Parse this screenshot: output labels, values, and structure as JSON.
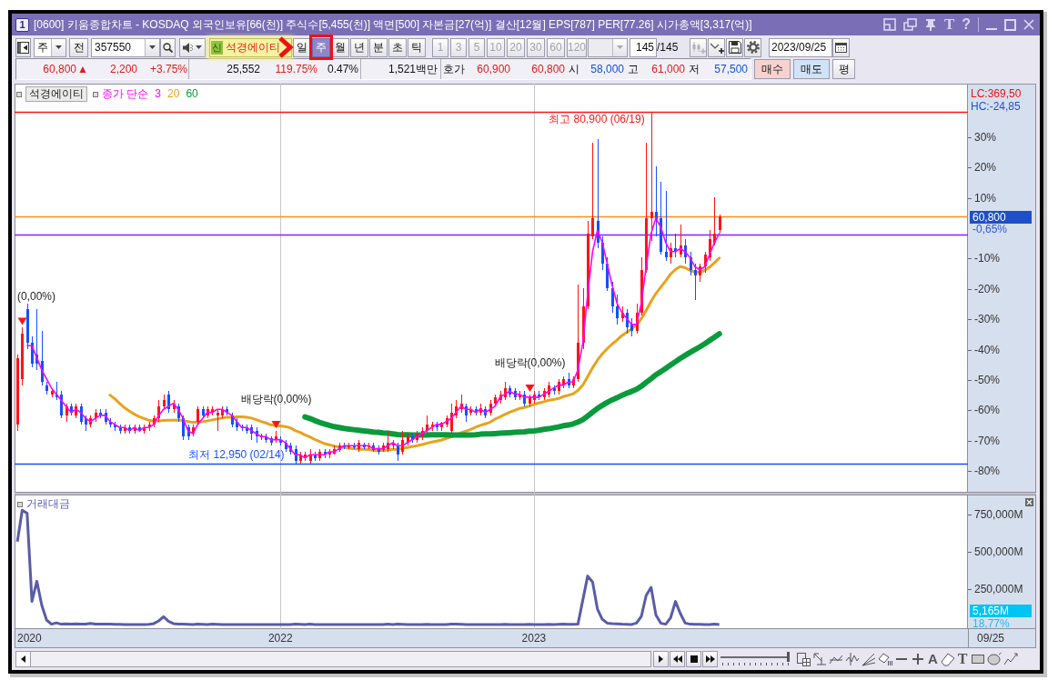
{
  "window": {
    "badge": "1",
    "title": "[0600] 키움종합차트 - KOSDAQ 외국인보유[66(천)] 주식수[5,455(천)] 액면[500] 자본금[27(억)] 결산[12월] EPS[787] PER[77.26] 시가총액[3,317(억)]",
    "font_button": "T",
    "help_button": "?"
  },
  "toolbar": {
    "market": "주",
    "all_button": "전",
    "code": "357550",
    "credit_badge": "신",
    "stock_name": "석경에이티",
    "periods": [
      {
        "label": "일",
        "selected": false
      },
      {
        "label": "주",
        "selected": true
      },
      {
        "label": "월",
        "selected": false
      },
      {
        "label": "년",
        "selected": false
      },
      {
        "label": "분",
        "selected": false
      },
      {
        "label": "초",
        "selected": false
      },
      {
        "label": "틱",
        "selected": false
      }
    ],
    "intervals": [
      {
        "label": "1",
        "disabled": true
      },
      {
        "label": "3",
        "disabled": true
      },
      {
        "label": "5",
        "disabled": true
      },
      {
        "label": "10",
        "disabled": true
      },
      {
        "label": "20",
        "disabled": true
      },
      {
        "label": "30",
        "disabled": true
      },
      {
        "label": "60",
        "disabled": true
      },
      {
        "label": "120",
        "disabled": true
      }
    ],
    "count": "145",
    "total": "/145",
    "date": "2023/09/25"
  },
  "quote": {
    "price": "60,800",
    "price_mark": "▲",
    "change": "2,200",
    "rate": "+3.75%",
    "up": true,
    "volume": "25,552",
    "volume_ratio": {
      "value": "119.75%",
      "up": true
    },
    "turnover": "0.47%",
    "trade_value": "1,521백만",
    "ask_label": "호가",
    "asks": [
      {
        "value": "60,900",
        "up": true
      },
      {
        "value": "60,800",
        "up": true
      }
    ],
    "prices": [
      {
        "label": "시",
        "value": "58,000",
        "up": false
      },
      {
        "label": "고",
        "value": "61,000",
        "up": true
      },
      {
        "label": "저",
        "value": "57,500",
        "up": false
      }
    ]
  },
  "order_buttons": [
    {
      "label": "매수",
      "kind": "buy"
    },
    {
      "label": "매도",
      "kind": "sell"
    },
    {
      "label": "평",
      "kind": "plain"
    }
  ],
  "price_pane": {
    "series_button": "석경에이티",
    "axis_notes": {
      "lc": "LC:369,50",
      "hc": "HC:-24,85"
    },
    "price_marker": {
      "value": "60,800",
      "change": "-0,65%"
    },
    "chart_data": [
      {
        "type": "candlestick",
        "legend_title": "종가 단순",
        "annotations": [
          "(0,00%)",
          "배당락(0,00%)",
          "배당락(0,00%)"
        ],
        "x": [
          "2020-12-21",
          "2020-12-28",
          "2021-01-04",
          "2021-01-11",
          "2021-01-18",
          "2021-01-25",
          "2021-02-01",
          "2021-02-08",
          "2021-02-15",
          "2021-02-22",
          "2021-03-01",
          "2021-03-08",
          "2021-03-15",
          "2021-03-22",
          "2021-03-29",
          "2021-04-05",
          "2021-04-12",
          "2021-04-19",
          "2021-04-26",
          "2021-05-03",
          "2021-05-10",
          "2021-05-17",
          "2021-05-24",
          "2021-05-31",
          "2021-06-07",
          "2021-06-14",
          "2021-06-21",
          "2021-06-28",
          "2021-07-05",
          "2021-07-12",
          "2021-07-19",
          "2021-07-26",
          "2021-08-02",
          "2021-08-09",
          "2021-08-16",
          "2021-08-23",
          "2021-08-30",
          "2021-09-06",
          "2021-09-13",
          "2021-09-20",
          "2021-09-27",
          "2021-10-04",
          "2021-10-11",
          "2021-10-18",
          "2021-10-25",
          "2021-11-01",
          "2021-11-08",
          "2021-11-15",
          "2021-11-22",
          "2021-11-29",
          "2021-12-06",
          "2021-12-13",
          "2021-12-20",
          "2021-12-27",
          "2022-01-03",
          "2022-01-10",
          "2022-01-17",
          "2022-01-24",
          "2022-01-31",
          "2022-02-07",
          "2022-02-14",
          "2022-02-21",
          "2022-02-28",
          "2022-03-07",
          "2022-03-14",
          "2022-03-21",
          "2022-03-28",
          "2022-04-04",
          "2022-04-11",
          "2022-04-18",
          "2022-04-25",
          "2022-05-02",
          "2022-05-09",
          "2022-05-16",
          "2022-05-23",
          "2022-05-30",
          "2022-06-06",
          "2022-06-13",
          "2022-06-20",
          "2022-06-27",
          "2022-07-04",
          "2022-07-11",
          "2022-07-18",
          "2022-07-25",
          "2022-08-01",
          "2022-08-08",
          "2022-08-15",
          "2022-08-22",
          "2022-08-29",
          "2022-09-05",
          "2022-09-12",
          "2022-09-19",
          "2022-09-26",
          "2022-10-03",
          "2022-10-10",
          "2022-10-17",
          "2022-10-24",
          "2022-10-31",
          "2022-11-07",
          "2022-11-14",
          "2022-11-21",
          "2022-11-28",
          "2022-12-05",
          "2022-12-12",
          "2022-12-19",
          "2022-12-26",
          "2023-01-02",
          "2023-01-09",
          "2023-01-16",
          "2023-01-23",
          "2023-01-30",
          "2023-02-06",
          "2023-02-13",
          "2023-02-20",
          "2023-02-27",
          "2023-03-06",
          "2023-03-13",
          "2023-03-20",
          "2023-03-27",
          "2023-04-03",
          "2023-04-10",
          "2023-04-17",
          "2023-04-24",
          "2023-05-01",
          "2023-05-08",
          "2023-05-15",
          "2023-05-22",
          "2023-05-29",
          "2023-06-05",
          "2023-06-12",
          "2023-06-19",
          "2023-06-26",
          "2023-07-03",
          "2023-07-10",
          "2023-07-17",
          "2023-07-24",
          "2023-07-31",
          "2023-08-07",
          "2023-08-14",
          "2023-08-21",
          "2023-08-28",
          "2023-09-04",
          "2023-09-11",
          "2023-09-18",
          "2023-09-25"
        ],
        "ohlc": [
          [
            -65,
            -42,
            -67,
            -43
          ],
          [
            -50,
            -33,
            -52,
            -35
          ],
          [
            -27,
            -25,
            -40,
            -38
          ],
          [
            -38,
            -36,
            -46,
            -45
          ],
          [
            -42,
            -27,
            -47,
            -45
          ],
          [
            -44,
            -34,
            -52,
            -51
          ],
          [
            -52,
            -51,
            -55,
            -54
          ],
          [
            -55,
            -53,
            -56,
            -54
          ],
          [
            -55,
            -51,
            -57,
            -56
          ],
          [
            -55,
            -54,
            -63,
            -62
          ],
          [
            -62,
            -58,
            -64,
            -59
          ],
          [
            -59,
            -58,
            -62,
            -61
          ],
          [
            -62,
            -58,
            -63,
            -59
          ],
          [
            -59,
            -58,
            -65,
            -64
          ],
          [
            -63,
            -62,
            -67,
            -65
          ],
          [
            -65,
            -62,
            -66,
            -63
          ],
          [
            -63,
            -60,
            -64,
            -61
          ],
          [
            -61,
            -60,
            -63,
            -62
          ],
          [
            -61,
            -60,
            -65,
            -64
          ],
          [
            -64,
            -63,
            -66,
            -65
          ],
          [
            -65,
            -64,
            -67,
            -66
          ],
          [
            -66,
            -65,
            -68,
            -67
          ],
          [
            -67,
            -65,
            -68,
            -66
          ],
          [
            -66,
            -65,
            -68,
            -67
          ],
          [
            -67,
            -65,
            -68,
            -66
          ],
          [
            -66,
            -65,
            -67.5,
            -67
          ],
          [
            -67,
            -65,
            -68,
            -66
          ],
          [
            -66,
            -64,
            -67,
            -65
          ],
          [
            -65,
            -62,
            -66,
            -63
          ],
          [
            -63,
            -57,
            -64,
            -59
          ],
          [
            -59,
            -55,
            -60,
            -57
          ],
          [
            -55,
            -54,
            -61,
            -60
          ],
          [
            -60,
            -57,
            -61,
            -58
          ],
          [
            -59,
            -58,
            -64,
            -63
          ],
          [
            -63,
            -62,
            -70,
            -69
          ],
          [
            -66,
            -65,
            -70,
            -69
          ],
          [
            -68,
            -65,
            -69,
            -66
          ],
          [
            -64,
            -59,
            -65,
            -60
          ],
          [
            -60,
            -59,
            -63,
            -62
          ],
          [
            -62,
            -59,
            -63,
            -60
          ],
          [
            -61,
            -59,
            -62,
            -60
          ],
          [
            -62,
            -60,
            -67,
            -61
          ],
          [
            -62,
            -59,
            -63,
            -60
          ],
          [
            -60,
            -59,
            -62,
            -61
          ],
          [
            -62,
            -61,
            -66,
            -65
          ],
          [
            -64,
            -63,
            -67,
            -66
          ],
          [
            -65.5,
            -65,
            -67,
            -66
          ],
          [
            -66,
            -65,
            -68,
            -67
          ],
          [
            -66,
            -65,
            -70,
            -68
          ],
          [
            -67,
            -66,
            -71,
            -69
          ],
          [
            -68.5,
            -68,
            -70,
            -69
          ],
          [
            -69,
            -68,
            -71,
            -70
          ],
          [
            -69.5,
            -69,
            -72,
            -71
          ],
          [
            -70,
            -67,
            -71,
            -69
          ],
          [
            -70,
            -69,
            -72,
            -71
          ],
          [
            -71,
            -70,
            -74,
            -73
          ],
          [
            -72,
            -71,
            -75,
            -74
          ],
          [
            -73,
            -72,
            -78,
            -77
          ],
          [
            -77,
            -74,
            -78,
            -75
          ],
          [
            -76,
            -74,
            -77,
            -75
          ],
          [
            -77,
            -73,
            -77.9,
            -75
          ],
          [
            -75,
            -74,
            -77,
            -76
          ],
          [
            -76,
            -73,
            -77,
            -74
          ],
          [
            -74,
            -73,
            -76,
            -75
          ],
          [
            -75,
            -73,
            -76,
            -74
          ],
          [
            -74.5,
            -72,
            -75,
            -73
          ],
          [
            -73.5,
            -71,
            -74,
            -72
          ],
          [
            -72,
            -71,
            -73,
            -72.5
          ],
          [
            -72.5,
            -71,
            -73,
            -72
          ],
          [
            -72,
            -71,
            -73,
            -72.5
          ],
          [
            -73,
            -70,
            -74,
            -71
          ],
          [
            -71.5,
            -71,
            -73,
            -72.5
          ],
          [
            -72.5,
            -71,
            -73,
            -72
          ],
          [
            -72,
            -71,
            -74,
            -73.5
          ],
          [
            -73,
            -72,
            -75,
            -74
          ],
          [
            -73.5,
            -71,
            -74,
            -72
          ],
          [
            -73,
            -67,
            -74,
            -71
          ],
          [
            -72,
            -70,
            -73,
            -71.5
          ],
          [
            -72,
            -71,
            -77,
            -75
          ],
          [
            -74,
            -67,
            -75,
            -70
          ],
          [
            -71,
            -68,
            -72,
            -69
          ],
          [
            -69,
            -68,
            -71,
            -70
          ],
          [
            -70,
            -67,
            -71,
            -68
          ],
          [
            -69,
            -66,
            -70,
            -67
          ],
          [
            -67,
            -62,
            -68,
            -65
          ],
          [
            -66,
            -64,
            -67,
            -65
          ],
          [
            -65,
            -64,
            -67,
            -66
          ],
          [
            -66,
            -64,
            -67,
            -64.5
          ],
          [
            -65,
            -62,
            -66,
            -63
          ],
          [
            -67,
            -58,
            -68,
            -61
          ],
          [
            -62,
            -57,
            -63,
            -59
          ],
          [
            -60,
            -55,
            -61,
            -58
          ],
          [
            -59,
            -58,
            -64,
            -62
          ],
          [
            -61,
            -59,
            -62,
            -60
          ],
          [
            -60,
            -59,
            -62,
            -61
          ],
          [
            -61,
            -58,
            -62,
            -59.5
          ],
          [
            -60,
            -59,
            -63,
            -62
          ],
          [
            -61,
            -57,
            -62,
            -58
          ],
          [
            -58,
            -55,
            -59,
            -56
          ],
          [
            -57,
            -54,
            -58,
            -55
          ],
          [
            -56,
            -51,
            -57,
            -53
          ],
          [
            -53,
            -52,
            -56,
            -55
          ],
          [
            -54,
            -53,
            -57,
            -56
          ],
          [
            -56,
            -54,
            -57,
            -55
          ],
          [
            -55,
            -54,
            -59,
            -58
          ],
          [
            -58,
            -55,
            -59,
            -56
          ],
          [
            -57,
            -54,
            -58,
            -55
          ],
          [
            -55,
            -54,
            -57,
            -56
          ],
          [
            -56,
            -53,
            -57,
            -54
          ],
          [
            -55,
            -51,
            -56,
            -52
          ],
          [
            -53,
            -52,
            -55,
            -54
          ],
          [
            -54,
            -50,
            -55,
            -51
          ],
          [
            -52,
            -49,
            -53,
            -50
          ],
          [
            -50,
            -48,
            -53,
            -52
          ],
          [
            -52,
            -49,
            -53,
            -50
          ],
          [
            -50,
            -19,
            -51,
            -38
          ],
          [
            -38,
            -20,
            -40,
            -26
          ],
          [
            -26,
            2,
            -27,
            -2
          ],
          [
            -3,
            28,
            -4,
            3
          ],
          [
            2,
            29,
            -7,
            -5
          ],
          [
            -5,
            -3,
            -14,
            -12
          ],
          [
            -12,
            -10,
            -21,
            -20
          ],
          [
            -20,
            -18,
            -28,
            -26
          ],
          [
            -26,
            -22,
            -32,
            -30
          ],
          [
            -30,
            -26,
            -31,
            -28
          ],
          [
            -28,
            -27,
            -35,
            -33
          ],
          [
            -32,
            -30,
            -36,
            -34
          ],
          [
            -34,
            -25,
            -35,
            -28
          ],
          [
            -28,
            -10,
            -29,
            -14
          ],
          [
            -14,
            28,
            -15,
            3
          ],
          [
            3,
            38.1,
            -4.5,
            5
          ],
          [
            5,
            20,
            -3,
            2
          ],
          [
            3,
            15,
            -9,
            -8
          ],
          [
            -8,
            12,
            -11,
            -10
          ],
          [
            -10,
            -5,
            -12,
            -7
          ],
          [
            -7,
            -2,
            -10,
            -8
          ],
          [
            -9,
            1,
            -10,
            -6
          ],
          [
            -6,
            -4,
            -12,
            -10
          ],
          [
            -10,
            -8,
            -16,
            -14
          ],
          [
            -14,
            -12,
            -24,
            -16
          ],
          [
            -16,
            -12,
            -18,
            -13
          ],
          [
            -13,
            -8,
            -15,
            -9
          ],
          [
            -10,
            -1,
            -11,
            -4
          ],
          [
            -5,
            10,
            -6,
            -2
          ],
          [
            -1,
            4.1,
            -1.9,
            3.75
          ]
        ],
        "series": [
          {
            "name": "3",
            "type": "line",
            "color": "#ff00ff",
            "values": [
              null,
              null,
              -39,
              -39,
              -43,
              -47,
              -50,
              -53,
              -55,
              -57,
              -59,
              -61,
              -60,
              -61,
              -63,
              -64,
              -63,
              -62,
              -62,
              -64,
              -65,
              -66,
              -66,
              -67,
              -66,
              -67,
              -66,
              -66,
              -65,
              -62,
              -60,
              -59,
              -58,
              -60,
              -63,
              -67,
              -68,
              -65,
              -63,
              -61,
              -61,
              -60,
              -60,
              -61,
              -62,
              -64,
              -66,
              -66,
              -67,
              -68,
              -69,
              -69,
              -70,
              -70,
              -70,
              -71,
              -73,
              -75,
              -75,
              -76,
              -75,
              -75,
              -75,
              -75,
              -74,
              -74,
              -73,
              -72,
              -72,
              -72,
              -72,
              -72,
              -72,
              -73,
              -73,
              -73,
              -72,
              -71,
              -72,
              -72,
              -71,
              -70,
              -69,
              -68,
              -67,
              -66,
              -65,
              -65,
              -64,
              -63,
              -61,
              -59,
              -60,
              -60,
              -61,
              -60,
              -61,
              -60,
              -59,
              -56,
              -55,
              -54,
              -55,
              -55,
              -56,
              -56,
              -56,
              -56,
              -55,
              -54,
              -53,
              -52,
              -52,
              -51,
              -51,
              -47,
              -38,
              -22,
              -8,
              -1,
              -5,
              -12,
              -19,
              -25,
              -28,
              -30,
              -32,
              -32,
              -25,
              -13,
              -2,
              3,
              0,
              -5,
              -8,
              -8,
              -7,
              -8,
              -10,
              -13,
              -14,
              -13,
              -9,
              -5,
              -2
            ]
          },
          {
            "name": "20",
            "type": "line",
            "color": "#e9a21b",
            "values": [
              null,
              null,
              null,
              null,
              null,
              null,
              null,
              null,
              null,
              null,
              null,
              null,
              null,
              null,
              null,
              null,
              null,
              null,
              null,
              -55.3,
              -56.5,
              -58.1,
              -59.5,
              -60.6,
              -61.6,
              -62.4,
              -63,
              -63.6,
              -63.9,
              -63.8,
              -63.7,
              -63.6,
              -63.6,
              -63.5,
              -63.7,
              -64,
              -64.3,
              -64.2,
              -64.1,
              -63.8,
              -63.5,
              -63.2,
              -62.9,
              -62.6,
              -62.6,
              -62.5,
              -62.5,
              -62.6,
              -62.9,
              -63.4,
              -64,
              -64.5,
              -65.1,
              -65.4,
              -65.5,
              -65.7,
              -66.1,
              -67,
              -67.6,
              -68.4,
              -69.1,
              -69.9,
              -70.6,
              -71.3,
              -71.7,
              -72.1,
              -72.4,
              -72.6,
              -72.8,
              -73,
              -73.1,
              -73.2,
              -73.3,
              -73.5,
              -73.7,
              -73.6,
              -73.5,
              -73.2,
              -73.2,
              -72.9,
              -72.6,
              -72.3,
              -72,
              -71.6,
              -71.2,
              -70.8,
              -70.5,
              -70.1,
              -69.6,
              -69.1,
              -68.5,
              -67.7,
              -67.2,
              -66.6,
              -65.9,
              -65.3,
              -64.8,
              -64.2,
              -63.2,
              -62.5,
              -61.7,
              -60.9,
              -60.3,
              -59.7,
              -59.4,
              -58.9,
              -58.4,
              -57.9,
              -57.5,
              -57,
              -56.8,
              -56.4,
              -55.8,
              -55.4,
              -54.9,
              -53.8,
              -52,
              -49.2,
              -46.3,
              -43.8,
              -41.7,
              -40,
              -38.5,
              -37.2,
              -35.7,
              -34.6,
              -33.5,
              -32.1,
              -30.1,
              -27.4,
              -24.4,
              -21.8,
              -19.7,
              -17.6,
              -15.4,
              -13.9,
              -12.9,
              -13.3,
              -14.2,
              -14.7,
              -14.8,
              -14.2,
              -13.1,
              -11.7,
              -10.1
            ]
          },
          {
            "name": "60",
            "type": "line",
            "color": "#0a9a3c",
            "values": [
              null,
              null,
              null,
              null,
              null,
              null,
              null,
              null,
              null,
              null,
              null,
              null,
              null,
              null,
              null,
              null,
              null,
              null,
              null,
              null,
              null,
              null,
              null,
              null,
              null,
              null,
              null,
              null,
              null,
              null,
              null,
              null,
              null,
              null,
              null,
              null,
              null,
              null,
              null,
              null,
              null,
              null,
              null,
              null,
              null,
              null,
              null,
              null,
              null,
              null,
              null,
              null,
              null,
              null,
              null,
              null,
              null,
              null,
              null,
              -62.5,
              -63,
              -63.7,
              -64.3,
              -64.8,
              -65.3,
              -65.7,
              -66,
              -66.3,
              -66.5,
              -66.7,
              -66.9,
              -67.1,
              -67.3,
              -67.5,
              -67.6,
              -67.8,
              -67.9,
              -68.1,
              -68.3,
              -68.4,
              -68.4,
              -68.5,
              -68.5,
              -68.5,
              -68.5,
              -68.4,
              -68.4,
              -68.4,
              -68.4,
              -68.5,
              -68.5,
              -68.5,
              -68.5,
              -68.5,
              -68.4,
              -68.2,
              -68.1,
              -68.1,
              -68,
              -67.9,
              -67.8,
              -67.7,
              -67.6,
              -67.5,
              -67.4,
              -67.2,
              -67.1,
              -66.9,
              -66.6,
              -66.4,
              -66.1,
              -65.8,
              -65.4,
              -65.2,
              -64.8,
              -64.2,
              -63.4,
              -62.2,
              -60.9,
              -59.7,
              -58.7,
              -57.7,
              -56.9,
              -56.2,
              -55.4,
              -54.7,
              -54.1,
              -53.4,
              -52.4,
              -51.1,
              -49.9,
              -48.6,
              -47.6,
              -46.5,
              -45.4,
              -44.3,
              -43.2,
              -42.2,
              -41.2,
              -40.3,
              -39.4,
              -38.4,
              -37.3,
              -36.2,
              -35.1
            ]
          },
          {
            "type": "scatter",
            "marker": "triangle-down",
            "color": "#ff1414",
            "x": [
              "2020-12-28",
              "2021-12-27",
              "2022-12-26"
            ],
            "values": [
              -31,
              -65,
              -53
            ]
          }
        ],
        "xlim": [
          "2020-12-17",
          "2024-09-16"
        ],
        "ylim": [
          -87.5,
          47.4
        ],
        "xticks": [
          "2022-01-03",
          "2023-01-02"
        ],
        "grid": "x",
        "tick_labels": "y",
        "yticks": [
          {
            "value": 30,
            "label": "30%"
          },
          {
            "value": 20,
            "label": "20%"
          },
          {
            "value": 10,
            "label": "10%"
          },
          {
            "value": -10,
            "label": "-10%"
          },
          {
            "value": -20,
            "label": "-20%"
          },
          {
            "value": -30,
            "label": "-30%"
          },
          {
            "value": -40,
            "label": "-40%"
          },
          {
            "value": -50,
            "label": "-50%"
          },
          {
            "value": -60,
            "label": "-60%"
          },
          {
            "value": -70,
            "label": "-70%"
          },
          {
            "value": -80,
            "label": "-80%"
          }
        ],
        "ref_lines": [
          {
            "axis": "y",
            "value": 38.1,
            "label": "최고 80,900 (06/19)",
            "color": "#ff1414"
          },
          {
            "axis": "y",
            "value": 3.75,
            "color": "#ff8c1e"
          },
          {
            "axis": "y",
            "value": -2.4,
            "color": "#8c1eff"
          },
          {
            "axis": "y",
            "value": -77.9,
            "label": "최저 12,950 (02/14)",
            "color": "#1450ff"
          }
        ]
      }
    ]
  },
  "volume_pane": {
    "value_marker": {
      "value": "5,165M",
      "ratio": "18,77%"
    },
    "x_start_label": "2020",
    "date_label": "09/25",
    "chart_data": [
      {
        "type": "line",
        "title": "거래대금",
        "color": "#5a5ca8",
        "x": [
          "2020-12-21",
          "2020-12-28",
          "2021-01-04",
          "2021-01-11",
          "2021-01-18",
          "2021-01-25",
          "2021-02-01",
          "2021-02-08",
          "2021-02-15",
          "2021-02-22",
          "2021-03-01",
          "2021-03-08",
          "2021-03-15",
          "2021-03-22",
          "2021-03-29",
          "2021-04-05",
          "2021-04-12",
          "2021-04-19",
          "2021-04-26",
          "2021-05-03",
          "2021-05-10",
          "2021-05-17",
          "2021-05-24",
          "2021-05-31",
          "2021-06-07",
          "2021-06-14",
          "2021-06-21",
          "2021-06-28",
          "2021-07-05",
          "2021-07-12",
          "2021-07-19",
          "2021-07-26",
          "2021-08-02",
          "2021-08-09",
          "2021-08-16",
          "2021-08-23",
          "2021-08-30",
          "2021-09-06",
          "2021-09-13",
          "2021-09-20",
          "2021-09-27",
          "2021-10-04",
          "2021-10-11",
          "2021-10-18",
          "2021-10-25",
          "2021-11-01",
          "2021-11-08",
          "2021-11-15",
          "2021-11-22",
          "2021-11-29",
          "2021-12-06",
          "2021-12-13",
          "2021-12-20",
          "2021-12-27",
          "2022-01-03",
          "2022-01-10",
          "2022-01-17",
          "2022-01-24",
          "2022-01-31",
          "2022-02-07",
          "2022-02-14",
          "2022-02-21",
          "2022-02-28",
          "2022-03-07",
          "2022-03-14",
          "2022-03-21",
          "2022-03-28",
          "2022-04-04",
          "2022-04-11",
          "2022-04-18",
          "2022-04-25",
          "2022-05-02",
          "2022-05-09",
          "2022-05-16",
          "2022-05-23",
          "2022-05-30",
          "2022-06-06",
          "2022-06-13",
          "2022-06-20",
          "2022-06-27",
          "2022-07-04",
          "2022-07-11",
          "2022-07-18",
          "2022-07-25",
          "2022-08-01",
          "2022-08-08",
          "2022-08-15",
          "2022-08-22",
          "2022-08-29",
          "2022-09-05",
          "2022-09-12",
          "2022-09-19",
          "2022-09-26",
          "2022-10-03",
          "2022-10-10",
          "2022-10-17",
          "2022-10-24",
          "2022-10-31",
          "2022-11-07",
          "2022-11-14",
          "2022-11-21",
          "2022-11-28",
          "2022-12-05",
          "2022-12-12",
          "2022-12-19",
          "2022-12-26",
          "2023-01-02",
          "2023-01-09",
          "2023-01-16",
          "2023-01-23",
          "2023-01-30",
          "2023-02-06",
          "2023-02-13",
          "2023-02-20",
          "2023-02-27",
          "2023-03-06",
          "2023-03-13",
          "2023-03-20",
          "2023-03-27",
          "2023-04-03",
          "2023-04-10",
          "2023-04-17",
          "2023-04-24",
          "2023-05-01",
          "2023-05-08",
          "2023-05-15",
          "2023-05-22",
          "2023-05-29",
          "2023-06-05",
          "2023-06-12",
          "2023-06-19",
          "2023-06-26",
          "2023-07-03",
          "2023-07-10",
          "2023-07-17",
          "2023-07-24",
          "2023-07-31",
          "2023-08-07",
          "2023-08-14",
          "2023-08-21",
          "2023-08-28",
          "2023-09-04",
          "2023-09-11",
          "2023-09-18",
          "2023-09-25"
        ],
        "values": [
          560000,
          770000,
          750000,
          160000,
          295000,
          135000,
          36000,
          8000,
          17000,
          8000,
          10000,
          9000,
          10000,
          9000,
          8000,
          13000,
          9000,
          8000,
          8000,
          8000,
          7000,
          7000,
          6000,
          6000,
          6000,
          6000,
          6000,
          7000,
          12000,
          30000,
          58000,
          28000,
          12000,
          9000,
          8000,
          7000,
          6000,
          9000,
          7000,
          6000,
          9000,
          7000,
          6000,
          5000,
          5000,
          5000,
          6000,
          5000,
          5000,
          5000,
          5000,
          5000,
          5000,
          6000,
          5000,
          5000,
          6000,
          8000,
          7000,
          6000,
          8000,
          6000,
          5000,
          5000,
          5000,
          5000,
          5000,
          5000,
          5000,
          5000,
          5000,
          5000,
          5000,
          5000,
          5000,
          6000,
          8000,
          6000,
          9000,
          7000,
          6000,
          5000,
          6000,
          6000,
          7000,
          6000,
          5000,
          5000,
          6000,
          9000,
          8000,
          7000,
          6000,
          6000,
          5000,
          5000,
          5000,
          6000,
          6000,
          6000,
          7000,
          6000,
          6000,
          5000,
          6000,
          7000,
          6000,
          6000,
          6000,
          7000,
          6000,
          7000,
          8000,
          7000,
          7000,
          8000,
          170000,
          330000,
          290000,
          110000,
          40000,
          15000,
          12000,
          10000,
          8000,
          7000,
          6000,
          15000,
          60000,
          200000,
          255000,
          70000,
          14000,
          8000,
          50000,
          160000,
          80000,
          15000,
          8000,
          7000,
          7000,
          6000,
          6000,
          9000,
          5165
        ],
        "xlim": [
          "2020-12-17",
          "2024-09-16"
        ],
        "ylim": [
          -25000,
          875000
        ],
        "grid": "x",
        "xticks": [
          {
            "value": "2022-01-03",
            "label": "2022"
          },
          {
            "value": "2023-01-02",
            "label": "2023"
          }
        ],
        "yticks": [
          {
            "value": 750000,
            "label": "750,000M"
          },
          {
            "value": 500000,
            "label": "500,000M"
          },
          {
            "value": 250000,
            "label": "250,000M"
          }
        ]
      }
    ]
  },
  "bottom_toolbar": {
    "zoom_slider": {
      "level": 1
    },
    "text_tool": "A",
    "text_style_tool": "T"
  }
}
